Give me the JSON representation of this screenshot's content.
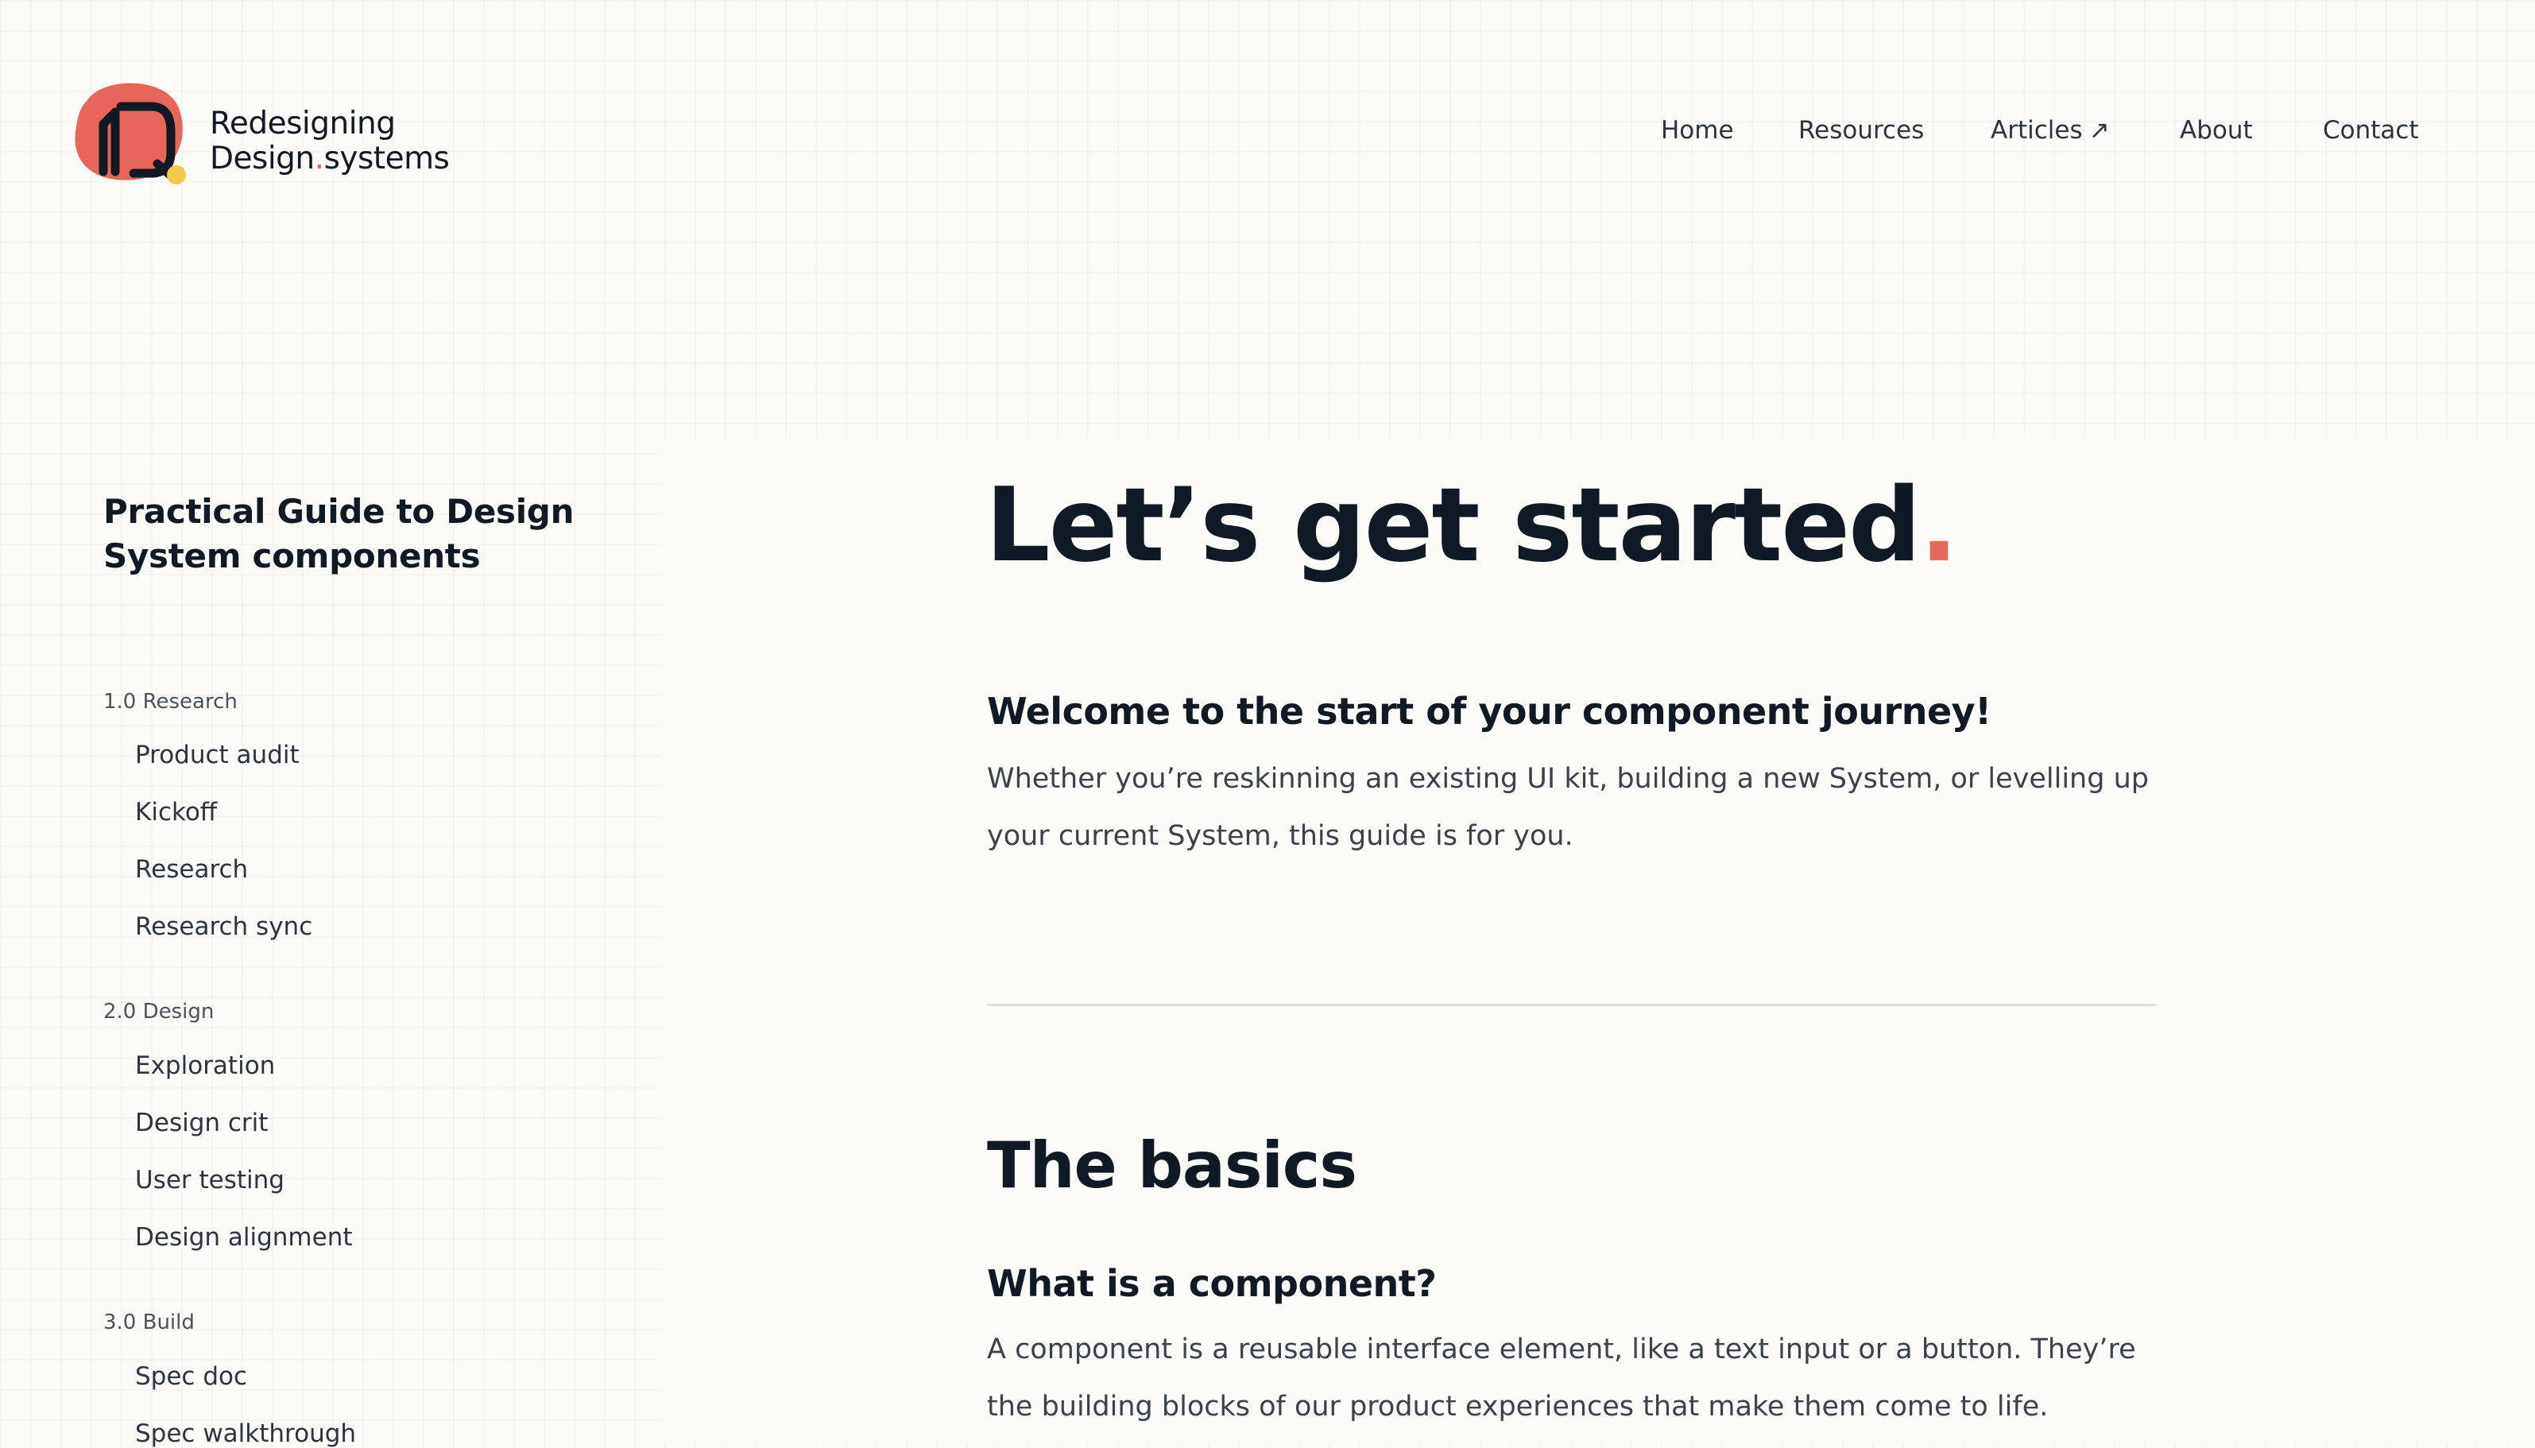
{
  "brand": {
    "line1": "Redesigning",
    "line2_a": "Design",
    "line2_dot": ".",
    "line2_b": "systems",
    "accent_color": "#e8655a",
    "secondary_color": "#f2c94c",
    "logo_icon": "redesigning-design-systems-logo"
  },
  "nav": {
    "items": [
      {
        "label": "Home"
      },
      {
        "label": "Resources"
      },
      {
        "label": "Articles",
        "icon": "external-arrow-icon",
        "arrow": "↗"
      },
      {
        "label": "About"
      },
      {
        "label": "Contact"
      }
    ]
  },
  "sidebar": {
    "title": "Practical Guide to Design System components",
    "sections": [
      {
        "label": "1.0 Research",
        "items": [
          "Product audit",
          "Kickoff",
          "Research",
          "Research sync"
        ]
      },
      {
        "label": "2.0 Design",
        "items": [
          "Exploration",
          "Design crit",
          "User testing",
          "Design alignment"
        ]
      },
      {
        "label": "3.0 Build",
        "items": [
          "Spec doc",
          "Spec walkthrough"
        ]
      }
    ]
  },
  "main": {
    "hero": "Let’s get started",
    "hero_dot": ".",
    "welcome_heading": "Welcome to the start of your component journey!",
    "welcome_text": "Whether you’re reskinning an existing UI kit, building a new System, or levelling up your current System, this guide is for you.",
    "basics_heading": "The basics",
    "component_heading": "What is a component?",
    "component_text": "A component is a reusable interface element, like a text input or a button. They’re the building blocks of our product experiences that make them come to life."
  }
}
